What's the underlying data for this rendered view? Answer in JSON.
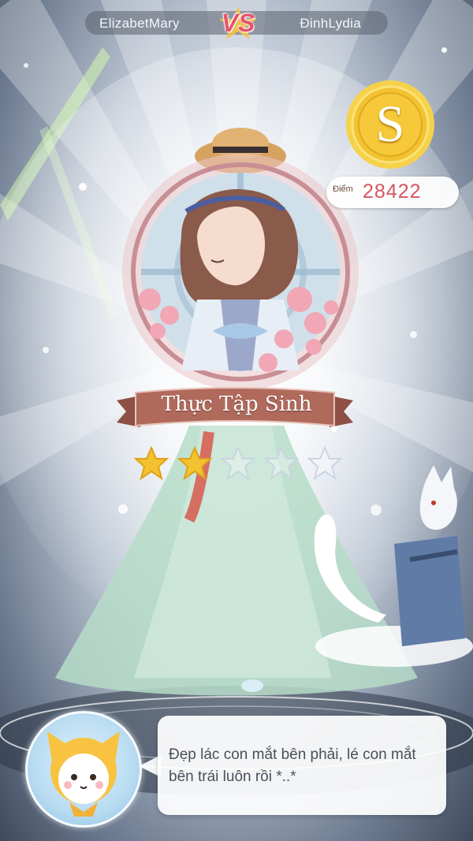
{
  "match": {
    "player_left": "ElizabetMary",
    "vs_label": "VS",
    "player_right": "ĐinhLydia"
  },
  "rank": {
    "letter": "S",
    "score_label": "Điểm",
    "score_value": "28422"
  },
  "character": {
    "rank_title": "Thực Tập Sinh",
    "stars_filled": 2,
    "stars_total": 5
  },
  "dialog": {
    "text": "Đẹp lác con mắt bên phải, lé con mắt bên trái luôn rồi *..*"
  },
  "colors": {
    "accent_pink": "#e6556b",
    "score_red": "#d9535f",
    "gold": "#f2c230",
    "ribbon_brown": "#b06a5c"
  },
  "icons": {
    "vs_star": "star-icon",
    "medal": "rank-medal-icon",
    "star_filled": "star-filled-icon",
    "star_empty": "star-empty-icon",
    "mascot": "cat-mascot-icon",
    "fox": "fox-spirit-icon"
  }
}
